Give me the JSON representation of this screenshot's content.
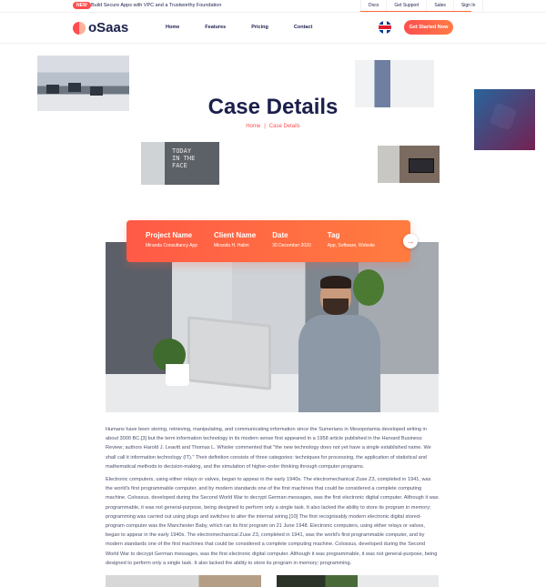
{
  "topbar": {
    "badge": "NEW",
    "promo": "Build Secure Apps with VPC and a Trustworthy Foundation",
    "links": [
      "Docs",
      "Get Support",
      "Sales",
      "Sign In"
    ]
  },
  "header": {
    "logo": "oSaas",
    "nav": [
      "Home",
      "Features",
      "Pricing",
      "Contact"
    ],
    "cta": "Get Started Now"
  },
  "hero": {
    "title": "Case Details",
    "breadcrumb": {
      "home": "Home",
      "separator": "|",
      "current": "Case Details"
    },
    "image_text": "TODAY\nIN THE\nFACE"
  },
  "project": {
    "fields": [
      {
        "label": "Project Name",
        "value": "Miranda Consultancy App"
      },
      {
        "label": "Client Name",
        "value": "Miranda H. Halim"
      },
      {
        "label": "Date",
        "value": "30 December 2020"
      },
      {
        "label": "Tag",
        "value": "App, Software, Website"
      }
    ],
    "next_icon": "→"
  },
  "article": {
    "paragraphs": [
      "Humans have been storing, retrieving, manipulating, and communicating information since the Sumerians in Mesopotamia developed writing in about 3000 BC.[3] but the term information technology in its modern sense first appeared in a 1958 article published in the Harvard Business Review; authors Harold J. Leavitt and Thomas L. Whisler commented that \"the new technology does not yet have a single established name. We shall call it information technology (IT).\" Their definition consists of three categories: techniques for processing, the application of statistical and mathematical methods to decision-making, and the simulation of higher-order thinking through computer programs.",
      "Electronic computers, using either relays or valves, began to appear in the early 1940s. The electromechanical Zuse Z3, completed in 1941, was the world's first programmable computer, and by modern standards one of the first machines that could be considered a complete computing machine. Colossus, developed during the Second World War to decrypt German messages, was the first electronic digital computer. Although it was programmable, it was not general-purpose, being designed to perform only a single task. It also lacked the ability to store its program in memory; programming was carried out using plugs and switches to alter the internal wiring.[10] The first recognisably modern electronic digital stored-program computer was the Manchester Baby, which ran its first program on 21 June 1948. Electronic computers, using either relays or valves, began to appear in the early 1940s. The electromechanical Zuse Z3, completed in 1941, was the world's first programmable computer, and by modern standards one of the first machines that could be considered a complete computing machine. Colossus, developed during the Second World War to decrypt German messages, was the first electronic digital computer. Although it was programmable, it was not general-purpose, being designed to perform only a single task. It also lacked the ability to store its program in memory; programming."
    ]
  },
  "colors": {
    "accent": "#ff5a46",
    "navy": "#1b1f4b"
  }
}
